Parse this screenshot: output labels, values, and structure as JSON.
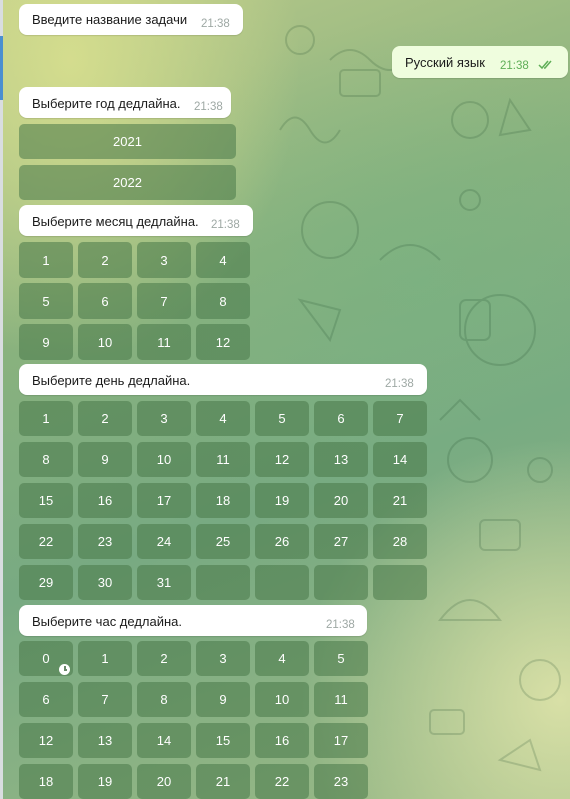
{
  "messages": [
    {
      "text": "Введите название задачи",
      "time": "21:38"
    },
    {
      "text": "Русский язык",
      "time": "21:38"
    },
    {
      "text": "Выберите год дедлайна.",
      "time": "21:38"
    },
    {
      "text": "Выберите месяц дедлайна.",
      "time": "21:38"
    },
    {
      "text": "Выберите день дедлайна.",
      "time": "21:38"
    },
    {
      "text": "Выберите час дедлайна.",
      "time": "21:38"
    }
  ],
  "keyboards": {
    "year": [
      "2021",
      "2022"
    ],
    "month": [
      "1",
      "2",
      "3",
      "4",
      "5",
      "6",
      "7",
      "8",
      "9",
      "10",
      "11",
      "12"
    ],
    "day": [
      "1",
      "2",
      "3",
      "4",
      "5",
      "6",
      "7",
      "8",
      "9",
      "10",
      "11",
      "12",
      "13",
      "14",
      "15",
      "16",
      "17",
      "18",
      "19",
      "20",
      "21",
      "22",
      "23",
      "24",
      "25",
      "26",
      "27",
      "28",
      "29",
      "30",
      "31",
      "",
      "",
      "",
      ""
    ],
    "hour": [
      "0",
      "1",
      "2",
      "3",
      "4",
      "5",
      "6",
      "7",
      "8",
      "9",
      "10",
      "11",
      "12",
      "13",
      "14",
      "15",
      "16",
      "17",
      "18",
      "19",
      "20",
      "21",
      "22",
      "23"
    ]
  },
  "icons": {
    "read_status": "double-check-icon",
    "pending": "clock-icon"
  },
  "colors": {
    "outgoing_bubble": "#effdde",
    "check": "#5fae57",
    "key": "#487848"
  }
}
